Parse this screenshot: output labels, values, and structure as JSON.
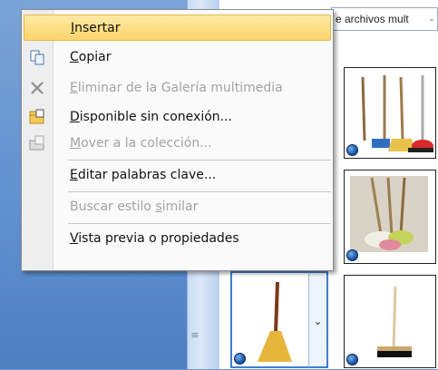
{
  "gallery": {
    "header_text": "e archivos mult",
    "dropdown_glyph": "⌄"
  },
  "splitter": {
    "grip_glyph": "≡"
  },
  "tile_arrow": {
    "glyph": "⌄"
  },
  "menu": {
    "items": [
      {
        "pre": "",
        "key": "I",
        "post": "nsertar",
        "enabled": true,
        "highlighted": true,
        "icon": ""
      },
      {
        "pre": "",
        "key": "C",
        "post": "opiar",
        "enabled": true,
        "icon": "copy-icon"
      },
      {
        "pre": "",
        "key": "E",
        "post": "liminar de la Galería multimedia",
        "enabled": false,
        "icon": "delete-x-icon"
      },
      {
        "pre": "",
        "key": "D",
        "post": "isponible sin conexión...",
        "enabled": true,
        "icon": "offline-folder-icon"
      },
      {
        "pre": "",
        "key": "M",
        "post": "over a la colección...",
        "enabled": false,
        "icon": "move-to-collection-icon"
      },
      {
        "pre": "",
        "key": "E",
        "post": "ditar palabras clave...",
        "enabled": true,
        "icon": ""
      },
      {
        "pre": "Buscar estilo ",
        "key": "s",
        "post": "imilar",
        "enabled": false,
        "icon": ""
      },
      {
        "pre": "",
        "key": "V",
        "post": "ista previa o propiedades",
        "enabled": true,
        "icon": ""
      }
    ]
  }
}
